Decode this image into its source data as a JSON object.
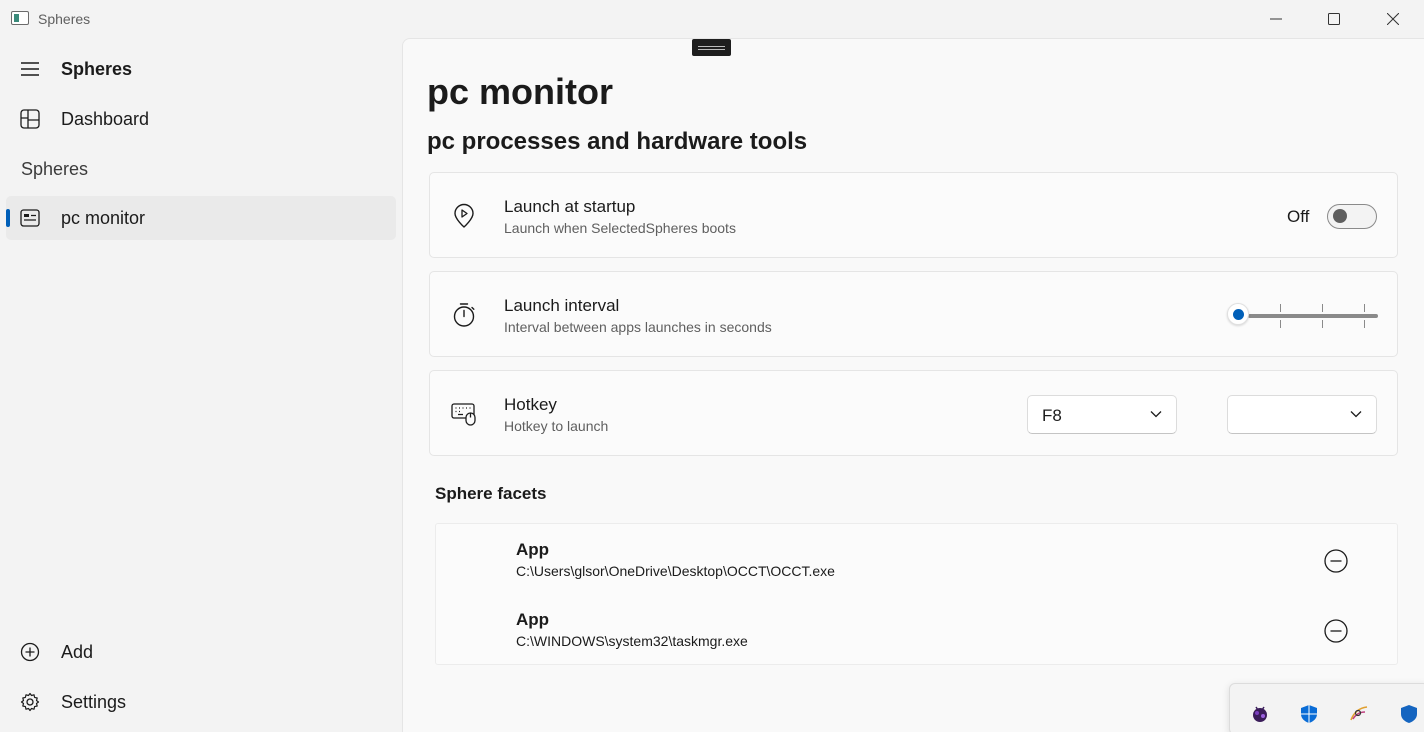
{
  "window": {
    "title": "Spheres"
  },
  "sidebar": {
    "app_title": "Spheres",
    "items": [
      {
        "label": "Dashboard",
        "icon": "dashboard-icon"
      },
      {
        "label": "pc monitor",
        "icon": "sphere-icon",
        "selected": true
      }
    ],
    "section_header": "Spheres",
    "footer_items": [
      {
        "label": "Add",
        "icon": "add-icon"
      },
      {
        "label": "Settings",
        "icon": "gear-icon"
      }
    ]
  },
  "page": {
    "title": "pc monitor",
    "subtitle": "pc processes and hardware tools"
  },
  "settings": {
    "launch_startup": {
      "title": "Launch at startup",
      "description": "Launch when SelectedSpheres boots",
      "state_label": "Off",
      "on": false
    },
    "launch_interval": {
      "title": "Launch interval",
      "description": "Interval between apps launches in seconds",
      "value_fraction": 0
    },
    "hotkey": {
      "title": "Hotkey",
      "description": "Hotkey to launch",
      "key_value": "F8",
      "modifier_value": ""
    }
  },
  "facets": {
    "title": "Sphere facets",
    "items": [
      {
        "type": "App",
        "path": "C:\\Users\\glsor\\OneDrive\\Desktop\\OCCT\\OCCT.exe"
      },
      {
        "type": "App",
        "path": "C:\\WINDOWS\\system32\\taskmgr.exe"
      }
    ]
  },
  "colors": {
    "accent": "#005fb8",
    "background": "#f3f3f3",
    "content_background": "#f9f9f9"
  },
  "tray_icons": [
    "purple-app-icon",
    "shield-icon",
    "color-picker-icon",
    "security-icon"
  ]
}
